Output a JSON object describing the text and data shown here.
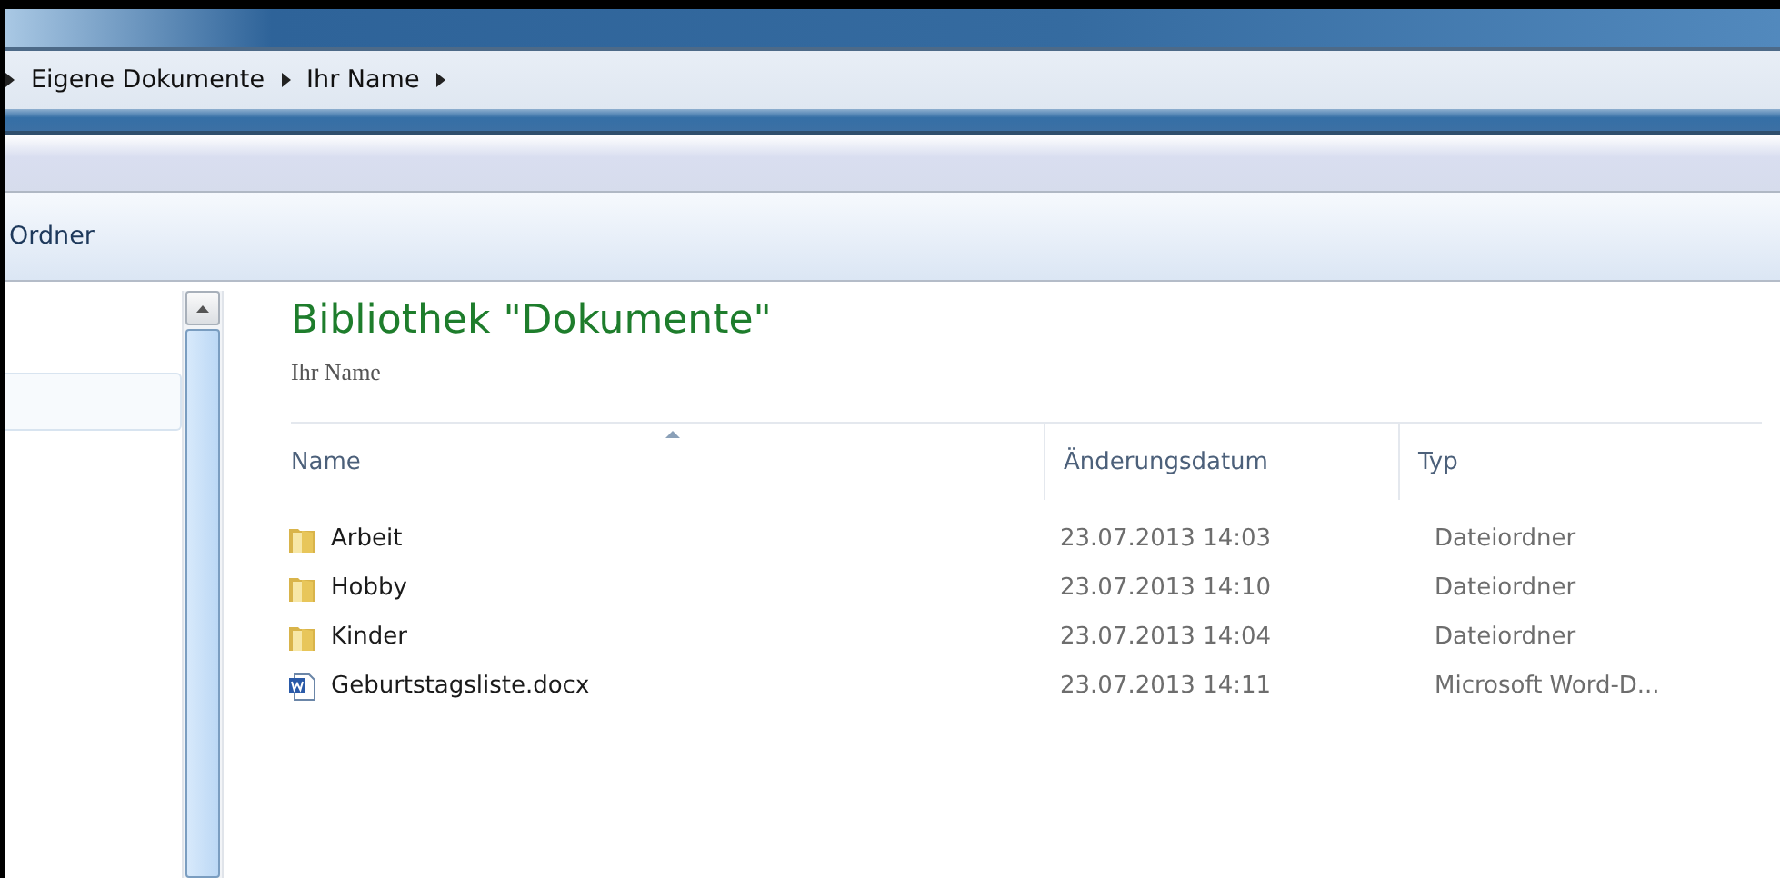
{
  "breadcrumb": [
    "Eigene Dokumente",
    "Ihr Name"
  ],
  "toolbar": {
    "label": "Ordner"
  },
  "library": {
    "title": "Bibliothek \"Dokumente\"",
    "subtitle": "Ihr Name"
  },
  "table": {
    "columns": [
      "Name",
      "Änderungsdatum",
      "Typ"
    ],
    "rows": [
      {
        "kind": "folder",
        "name": "Arbeit",
        "date": "23.07.2013 14:03",
        "type": "Dateiordner"
      },
      {
        "kind": "folder",
        "name": "Hobby",
        "date": "23.07.2013 14:10",
        "type": "Dateiordner"
      },
      {
        "kind": "folder",
        "name": "Kinder",
        "date": "23.07.2013 14:04",
        "type": "Dateiordner"
      },
      {
        "kind": "word",
        "name": "Geburtstagsliste.docx",
        "date": "23.07.2013 14:11",
        "type": "Microsoft Word-D..."
      }
    ]
  }
}
